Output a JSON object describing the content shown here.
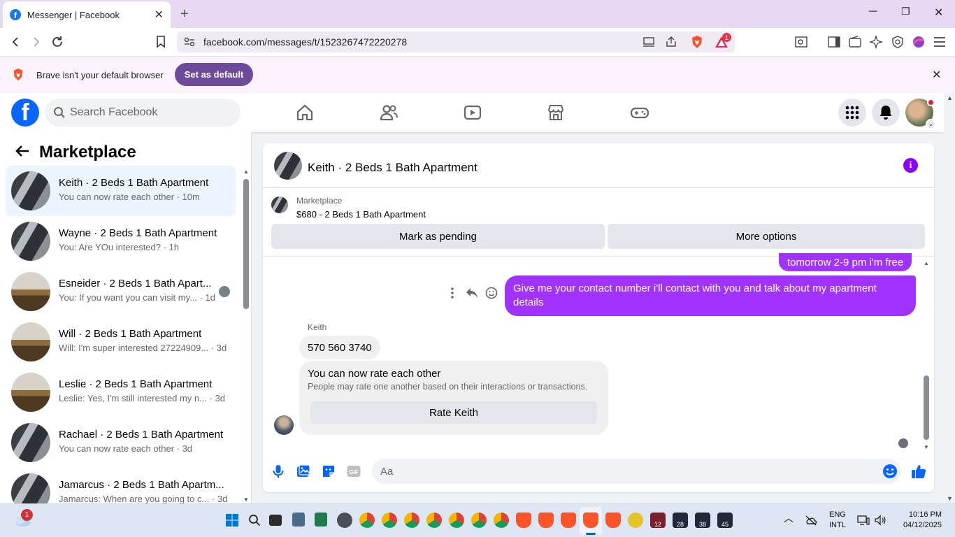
{
  "browser": {
    "tab_title": "Messenger | Facebook",
    "url": "facebook.com/messages/t/1523267472220278",
    "notification_count": "1",
    "infobar_message": "Brave isn't your default browser",
    "infobar_button": "Set as default"
  },
  "facebook": {
    "search_placeholder": "Search Facebook",
    "nav_icons": [
      "home-icon",
      "friends-icon",
      "watch-icon",
      "marketplace-icon",
      "gaming-icon"
    ]
  },
  "sidebar": {
    "title": "Marketplace",
    "chats": [
      {
        "name": "Keith · 2 Beds 1 Bath Apartment",
        "snippet": "You can now rate each other · 10m",
        "active": true
      },
      {
        "name": "Wayne · 2 Beds 1 Bath Apartment",
        "snippet": "You: Are YOu interested? · 1h"
      },
      {
        "name": "Esneider · 2 Beds 1 Bath Apart...",
        "snippet": "You: If you want you can visit my... · 1d"
      },
      {
        "name": "Will · 2 Beds 1 Bath Apartment",
        "snippet": "Will: I'm super interested 27224909... · 3d"
      },
      {
        "name": "Leslie · 2 Beds 1 Bath Apartment",
        "snippet": "Leslie: Yes, I'm still interested my n... · 3d"
      },
      {
        "name": "Rachael · 2 Beds 1 Bath Apartment",
        "snippet": "You can now rate each other · 3d"
      },
      {
        "name": "Jamarcus · 2 Beds 1 Bath Apartm...",
        "snippet": "Jamarcus: When are you going to c... · 3d"
      }
    ]
  },
  "conversation": {
    "title": "Keith · 2 Beds 1 Bath Apartment",
    "listing": {
      "label": "Marketplace",
      "item": "$680 - 2 Beds 1 Bath Apartment",
      "mark_pending": "Mark as pending",
      "more_options": "More options"
    },
    "messages": {
      "sent_1": "tomorrow 2-9 pm i'm free",
      "sent_2": "Give me your contact number i'll contact with you and talk about my apartment details",
      "sender_name": "Keith",
      "received_1": "570 560 3740",
      "rate_title": "You can now rate each other",
      "rate_desc": "People may rate one another based on their interactions or transactions.",
      "rate_button": "Rate Keith"
    },
    "composer_placeholder": "Aa"
  },
  "taskbar": {
    "weather_badge": "1",
    "lang": "ENG",
    "layout": "INTL",
    "time": "10:16 PM",
    "date": "04/12/2025",
    "badges": [
      "12",
      "28",
      "38",
      "45"
    ]
  },
  "colors": {
    "brand": "#0866ff",
    "outgoing_bubble": "#a033ff",
    "brave_purple": "#6e4b9a"
  }
}
